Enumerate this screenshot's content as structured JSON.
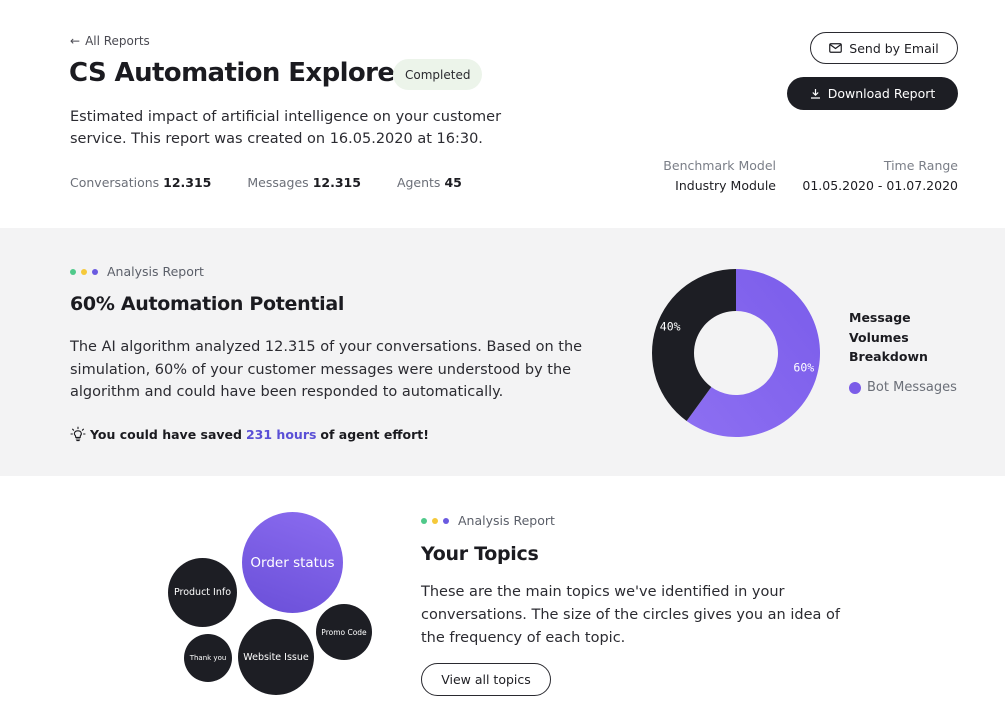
{
  "header": {
    "back_link": "All Reports",
    "title": "CS Automation Explorer",
    "status_badge": "Completed",
    "description": "Estimated impact of artificial intelligence on your customer service. This report was created on 16.05.2020 at 16:30.",
    "stats": [
      {
        "label": "Conversations",
        "value": "12.315"
      },
      {
        "label": "Messages",
        "value": "12.315"
      },
      {
        "label": "Agents",
        "value": "45"
      }
    ],
    "send_email_label": "Send by Email",
    "download_label": "Download Report",
    "benchmark": {
      "label": "Benchmark Model",
      "value": "Industry Module"
    },
    "time_range": {
      "label": "Time Range",
      "value": "01.05.2020 - 01.07.2020"
    }
  },
  "analysis": {
    "eyebrow": "Analysis Report",
    "title": "60% Automation Potential",
    "body": "The AI algorithm analyzed 12.315 of your conversations. Based on the simulation, 60% of your customer messages were understood by the algorithm and could have been responded to automatically.",
    "saved_prefix": "You could have saved",
    "saved_highlight": "231 hours",
    "saved_suffix": "of agent effort!",
    "icon": "lightbulb-icon"
  },
  "chart_data": {
    "type": "pie",
    "title": "Message Volumes Breakdown",
    "slices": [
      {
        "label": "Bot Messages",
        "value": 60,
        "display": "60%",
        "color": "#7b5ce8"
      },
      {
        "label": "",
        "value": 40,
        "display": "40%",
        "color": "#1d1e24"
      }
    ],
    "legend": [
      "Bot Messages"
    ],
    "legend_position": "right"
  },
  "topics": {
    "eyebrow": "Analysis Report",
    "title": "Your Topics",
    "body": "These are the main topics we've identified in your conversations. The size of the circles gives you an idea of the frequency of each topic.",
    "button_label": "View all topics",
    "bubbles": [
      {
        "label": "Order status",
        "color": "#7b5ce8"
      },
      {
        "label": "Product Info",
        "color": "#1d1e24"
      },
      {
        "label": "Promo Code",
        "color": "#1d1e24"
      },
      {
        "label": "Thank you",
        "color": "#1d1e24"
      },
      {
        "label": "Website Issue",
        "color": "#1d1e24"
      }
    ]
  },
  "colors": {
    "accent": "#7b5ce8",
    "dark": "#1d1e24",
    "dot_green": "#4fc98a",
    "dot_yellow": "#f5c93a",
    "dot_purple": "#6a5ae0",
    "highlight_text": "#5a4fd6"
  }
}
